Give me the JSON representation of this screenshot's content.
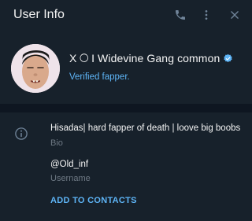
{
  "header": {
    "title": "User Info",
    "actions": [
      {
        "icon": "phone-icon"
      },
      {
        "icon": "more-vertical-icon"
      },
      {
        "icon": "close-icon"
      }
    ]
  },
  "profile": {
    "name_prefix": "X",
    "name_emoji": "🌕",
    "name_rest": "I Widevine Gang common",
    "status": "Verified fapper.",
    "verified_badge": true
  },
  "info": {
    "bio": {
      "value": "Hisadas| hard fapper of death | loove big boobs",
      "label": "Bio"
    },
    "username": {
      "value": "@Old_inf",
      "label": "Username"
    },
    "add_contact_label": "ADD TO CONTACTS"
  },
  "colors": {
    "background": "#17212b",
    "divider": "#0e1621",
    "accent": "#5eb5f7",
    "secondary_text": "#6d7883"
  }
}
